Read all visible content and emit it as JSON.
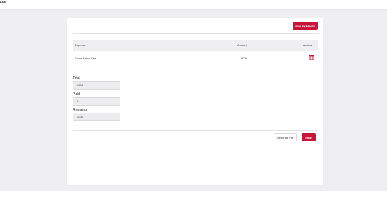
{
  "header": {
    "title": "oice"
  },
  "toolbar": {
    "add_expense_label": "ADD EXPENSE"
  },
  "table": {
    "headers": {
      "expense": "Expense",
      "amount": "Amount",
      "actions": "Actions"
    },
    "rows": [
      {
        "expense": "Consultation Fee",
        "amount": "3000",
        "action_icon": "trash-icon"
      }
    ]
  },
  "summary": {
    "total": {
      "label": "Total",
      "value": "3000"
    },
    "paid": {
      "label": "Paid",
      "value": "0"
    },
    "remaining": {
      "label": "Remaing",
      "value": "3000"
    }
  },
  "footer": {
    "generate_pdf_label": "Generate Pdf",
    "paid_label": "PAID"
  },
  "colors": {
    "accent": "#c8163a",
    "background": "#efeff1",
    "card": "#ffffff"
  }
}
